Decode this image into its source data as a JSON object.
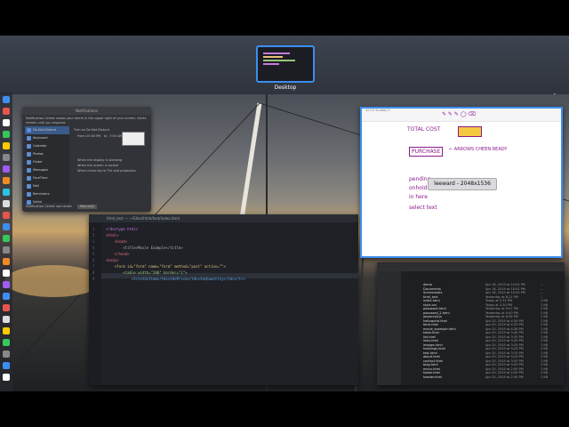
{
  "mission_control": {
    "space_label": "Desktop",
    "add_space": "+"
  },
  "notes": {
    "header": "10:15  Sunday 5",
    "lines": {
      "total_cost": "TOTAL COST",
      "purchase": "PURCHASE",
      "arrow_note": "← ARROWS CHEEN READY",
      "pending": "pending",
      "onhold": "onhold",
      "inhere": "in here",
      "selected": "select text"
    },
    "tooltip": "leeward - 2048x1536"
  },
  "editor": {
    "tab": "html_test — ~/Sites/html/test/index.html",
    "lines": [
      {
        "n": "1",
        "t": "<!doctype html>"
      },
      {
        "n": "2",
        "t": "<html>"
      },
      {
        "n": "3",
        "t": "    <head>"
      },
      {
        "n": "4",
        "t": "        <title>Movie Example</title>"
      },
      {
        "n": "5",
        "t": "    </head>"
      },
      {
        "n": "6",
        "t": "<body>"
      },
      {
        "n": "7",
        "t": "    <form id=\"form\" name=\"form\" method=\"post\" action=\"\">"
      },
      {
        "n": "8",
        "t": "        <table width=\"200\" border=\"1\">"
      },
      {
        "n": "9",
        "t": "            <tr><td>Item</td><td>Price</td><td>Quantity</td></tr>"
      }
    ]
  },
  "notification_prefs": {
    "title": "Notifications",
    "intro": "Notification Center shows your alerts in the upper right of your screen. Alerts remain until you respond.",
    "apps": [
      "Do Not Disturb",
      "Keyboard",
      "Calendar",
      "Photos",
      "Finder",
      "Messages",
      "FaceTime",
      "Mail",
      "Reminders",
      "Safari"
    ],
    "dnd_label": "Turn on Do Not Disturb",
    "from": "From:",
    "from_time": "10:00 PM",
    "to": "to",
    "to_time": "7:00 AM",
    "option1": "When the display is sleeping",
    "option2": "When the screen is locked",
    "option3": "When mirroring to TVs and projectors",
    "footer": "Notification Center sort order:",
    "sort": "Manually"
  },
  "finder": {
    "rows": [
      {
        "name": "demo",
        "date": "Apr 18, 2019 at 10:02 PM",
        "size": "--"
      },
      {
        "name": "Documents",
        "date": "Apr 18, 2019 at 10:01 PM",
        "size": "--"
      },
      {
        "name": "Screenshots",
        "date": "Apr 18, 2019 at 10:00 PM",
        "size": "--"
      },
      {
        "name": "html_test",
        "date": "Yesterday at 8:11 PM",
        "size": "--"
      },
      {
        "name": "index.html",
        "date": "Today at 2:31 PM",
        "size": "1 KB"
      },
      {
        "name": "style.css",
        "date": "Today at 2:30 PM",
        "size": "1 KB"
      },
      {
        "name": "password.html",
        "date": "Yesterday at 9:07 PM",
        "size": "2 KB"
      },
      {
        "name": "password_2.html",
        "date": "Yesterday at 9:00 PM",
        "size": "2 KB"
      },
      {
        "name": "javascript.js",
        "date": "Yesterday at 8:58 PM",
        "size": "1 KB"
      },
      {
        "name": "helloworld.html",
        "date": "Apr 20, 2019 at 4:35 PM",
        "size": "1 KB"
      },
      {
        "name": "form.html",
        "date": "Apr 20, 2019 at 4:33 PM",
        "size": "2 KB"
      },
      {
        "name": "movie_example.html",
        "date": "Apr 20, 2019 at 4:28 PM",
        "size": "1 KB"
      },
      {
        "name": "table.html",
        "date": "Apr 20, 2019 at 3:40 PM",
        "size": "1 KB"
      },
      {
        "name": "list.html",
        "date": "Apr 20, 2019 at 3:35 PM",
        "size": "1 KB"
      },
      {
        "name": "links.html",
        "date": "Apr 20, 2019 at 3:30 PM",
        "size": "1 KB"
      },
      {
        "name": "images.html",
        "date": "Apr 20, 2019 at 3:25 PM",
        "size": "1 KB"
      },
      {
        "name": "headings.html",
        "date": "Apr 20, 2019 at 3:20 PM",
        "size": "1 KB"
      },
      {
        "name": "test.html",
        "date": "Apr 20, 2019 at 3:15 PM",
        "size": "1 KB"
      },
      {
        "name": "about.html",
        "date": "Apr 20, 2019 at 3:10 PM",
        "size": "1 KB"
      },
      {
        "name": "contact.html",
        "date": "Apr 20, 2019 at 3:05 PM",
        "size": "1 KB"
      },
      {
        "name": "blog.html",
        "date": "Apr 20, 2019 at 3:00 PM",
        "size": "1 KB"
      },
      {
        "name": "menu.html",
        "date": "Apr 20, 2019 at 2:55 PM",
        "size": "1 KB"
      },
      {
        "name": "footer.html",
        "date": "Apr 20, 2019 at 2:50 PM",
        "size": "1 KB"
      },
      {
        "name": "header.html",
        "date": "Apr 20, 2019 at 2:45 PM",
        "size": "1 KB"
      }
    ]
  }
}
